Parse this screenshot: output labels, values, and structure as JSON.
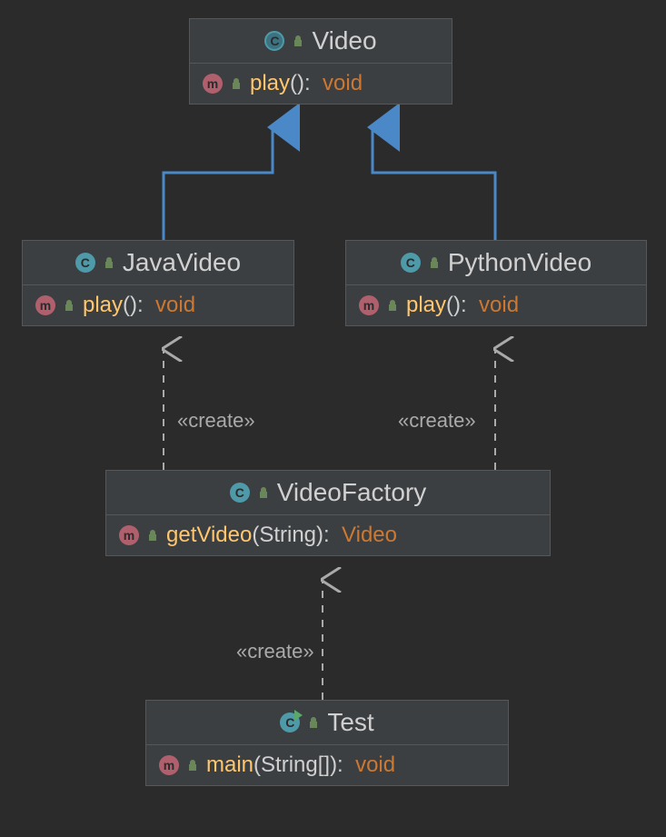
{
  "diagram": {
    "classes": {
      "video": {
        "name": "Video",
        "methods": [
          {
            "name": "play",
            "params": "",
            "return": "void"
          }
        ]
      },
      "javaVideo": {
        "name": "JavaVideo",
        "methods": [
          {
            "name": "play",
            "params": "",
            "return": "void"
          }
        ]
      },
      "pythonVideo": {
        "name": "PythonVideo",
        "methods": [
          {
            "name": "play",
            "params": "",
            "return": "void"
          }
        ]
      },
      "videoFactory": {
        "name": "VideoFactory",
        "methods": [
          {
            "name": "getVideo",
            "params": "String",
            "return": "Video"
          }
        ]
      },
      "test": {
        "name": "Test",
        "methods": [
          {
            "name": "main",
            "params": "String[]",
            "return": "void"
          }
        ]
      }
    },
    "labels": {
      "create1": "«create»",
      "create2": "«create»",
      "create3": "«create»"
    },
    "relationships": [
      {
        "from": "JavaVideo",
        "to": "Video",
        "type": "generalization"
      },
      {
        "from": "PythonVideo",
        "to": "Video",
        "type": "generalization"
      },
      {
        "from": "VideoFactory",
        "to": "JavaVideo",
        "type": "dependency",
        "label": "«create»"
      },
      {
        "from": "VideoFactory",
        "to": "PythonVideo",
        "type": "dependency",
        "label": "«create»"
      },
      {
        "from": "Test",
        "to": "VideoFactory",
        "type": "dependency",
        "label": "«create»"
      }
    ]
  }
}
